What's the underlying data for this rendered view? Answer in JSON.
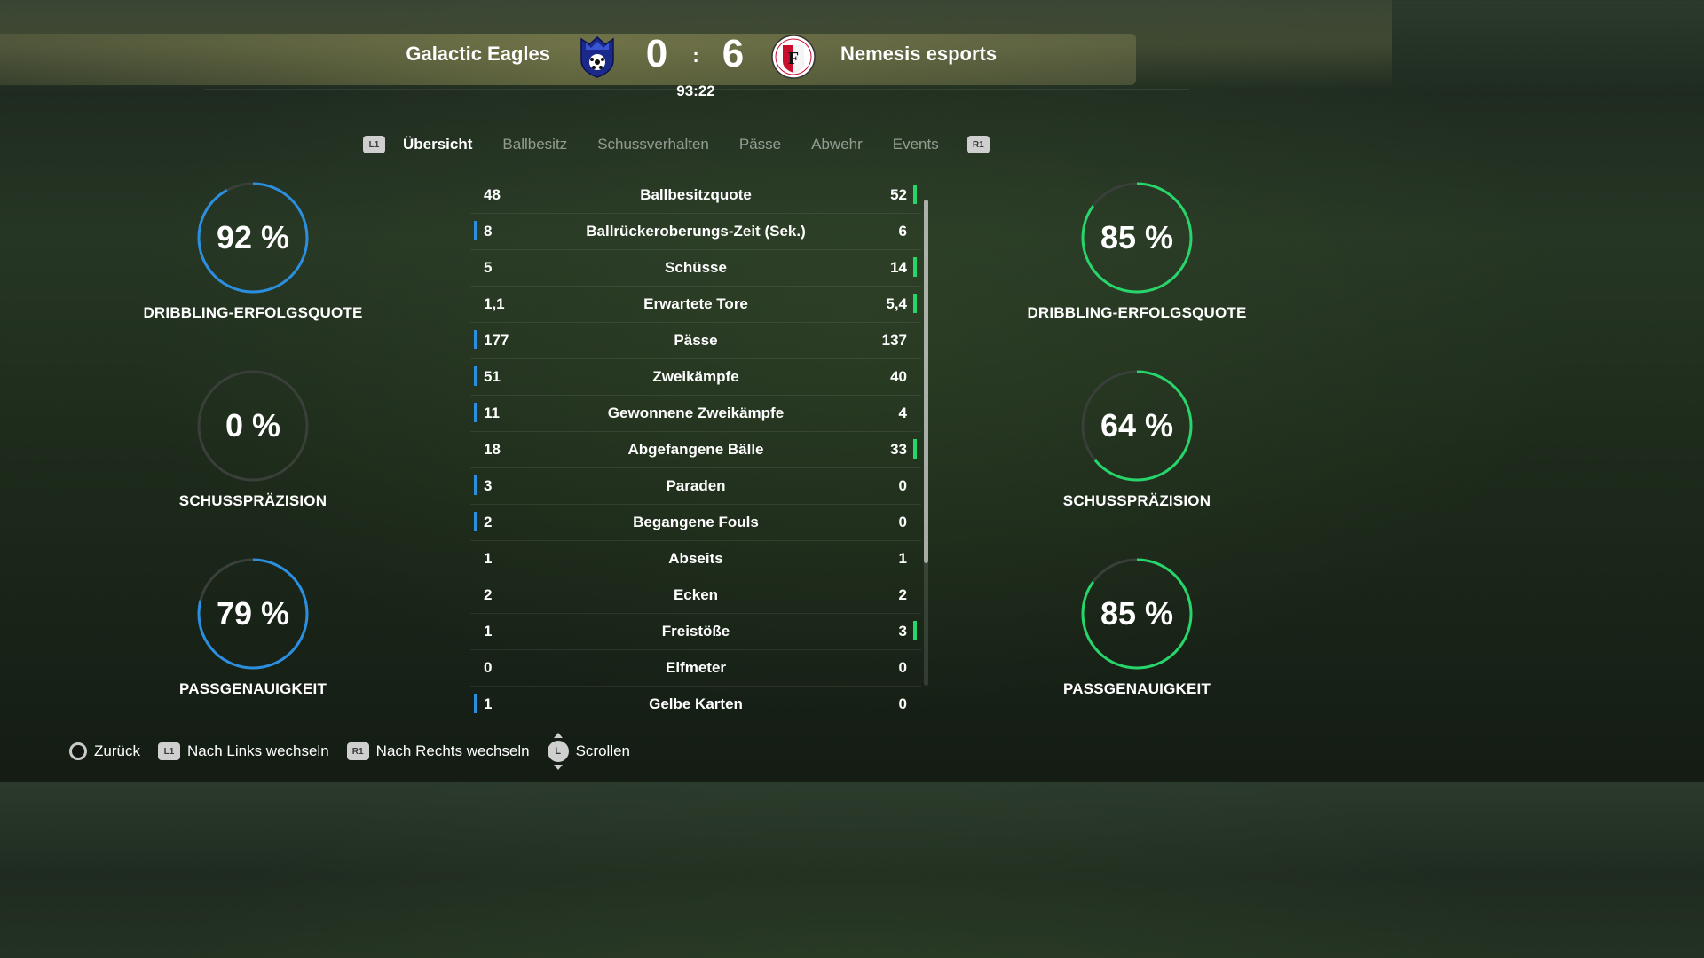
{
  "match": {
    "home_team": "Galactic Eagles",
    "away_team": "Nemesis esports",
    "home_score": "0",
    "separator": ":",
    "away_score": "6",
    "clock": "93:22",
    "home_crest_icon": "eagle-crest-icon",
    "away_crest_icon": "feyenoord-crest-icon"
  },
  "tabs": {
    "left_button": "L1",
    "right_button": "R1",
    "items": [
      {
        "label": "Übersicht",
        "active": true
      },
      {
        "label": "Ballbesitz",
        "active": false
      },
      {
        "label": "Schussverhalten",
        "active": false
      },
      {
        "label": "Pässe",
        "active": false
      },
      {
        "label": "Abwehr",
        "active": false
      },
      {
        "label": "Events",
        "active": false
      }
    ]
  },
  "colors": {
    "home_accent": "#2b8fe0",
    "away_accent": "#27d66b",
    "ring_track": "#3a3f3a"
  },
  "home_rings": [
    {
      "value": "92 %",
      "fraction": 0.92,
      "label": "DRIBBLING-ERFOLGSQUOTE"
    },
    {
      "value": "0 %",
      "fraction": 0.0,
      "label": "SCHUSSPRÄZISION"
    },
    {
      "value": "79 %",
      "fraction": 0.79,
      "label": "PASSGENAUIGKEIT"
    }
  ],
  "away_rings": [
    {
      "value": "85 %",
      "fraction": 0.85,
      "label": "DRIBBLING-ERFOLGSQUOTE"
    },
    {
      "value": "64 %",
      "fraction": 0.64,
      "label": "SCHUSSPRÄZISION"
    },
    {
      "value": "85 %",
      "fraction": 0.85,
      "label": "PASSGENAUIGKEIT"
    }
  ],
  "stats": [
    {
      "home": "48",
      "name": "Ballbesitzquote",
      "away": "52",
      "leader": "away"
    },
    {
      "home": "8",
      "name": "Ballrückeroberungs-Zeit (Sek.)",
      "away": "6",
      "leader": "home"
    },
    {
      "home": "5",
      "name": "Schüsse",
      "away": "14",
      "leader": "away"
    },
    {
      "home": "1,1",
      "name": "Erwartete Tore",
      "away": "5,4",
      "leader": "away"
    },
    {
      "home": "177",
      "name": "Pässe",
      "away": "137",
      "leader": "home"
    },
    {
      "home": "51",
      "name": "Zweikämpfe",
      "away": "40",
      "leader": "home"
    },
    {
      "home": "11",
      "name": "Gewonnene Zweikämpfe",
      "away": "4",
      "leader": "home"
    },
    {
      "home": "18",
      "name": "Abgefangene Bälle",
      "away": "33",
      "leader": "away"
    },
    {
      "home": "3",
      "name": "Paraden",
      "away": "0",
      "leader": "home"
    },
    {
      "home": "2",
      "name": "Begangene Fouls",
      "away": "0",
      "leader": "home"
    },
    {
      "home": "1",
      "name": "Abseits",
      "away": "1",
      "leader": "none"
    },
    {
      "home": "2",
      "name": "Ecken",
      "away": "2",
      "leader": "none"
    },
    {
      "home": "1",
      "name": "Freistöße",
      "away": "3",
      "leader": "away"
    },
    {
      "home": "0",
      "name": "Elfmeter",
      "away": "0",
      "leader": "none"
    },
    {
      "home": "1",
      "name": "Gelbe Karten",
      "away": "0",
      "leader": "home"
    }
  ],
  "footer": {
    "back_label": "Zurück",
    "left_badge": "L1",
    "left_label": "Nach Links wechseln",
    "right_badge": "R1",
    "right_label": "Nach Rechts wechseln",
    "stick_badge": "L",
    "scroll_label": "Scrollen"
  }
}
